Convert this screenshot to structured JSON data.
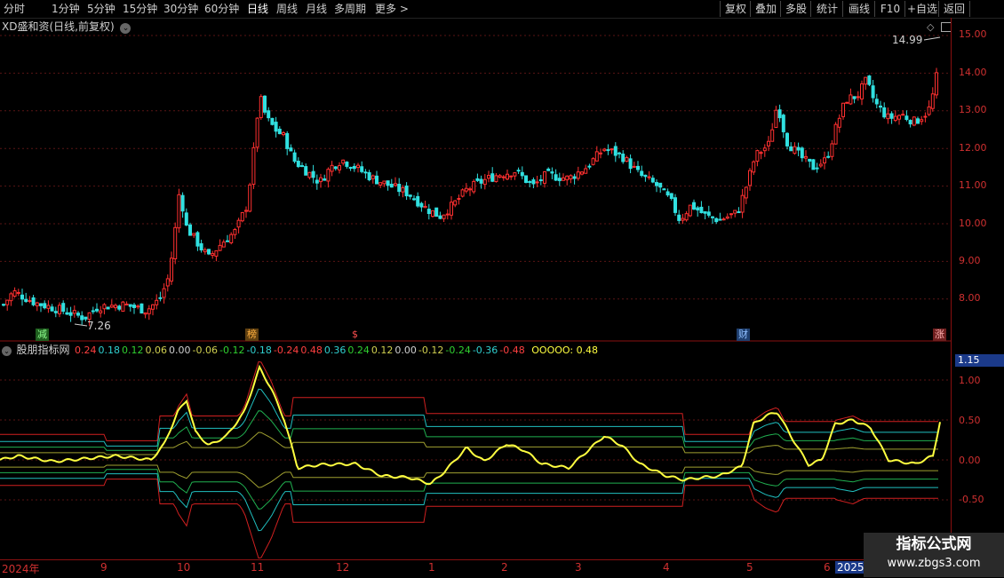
{
  "toolbar": {
    "timeframes": [
      "分时",
      "1分钟",
      "5分钟",
      "15分钟",
      "30分钟",
      "60分钟",
      "日线",
      "周线",
      "月线",
      "多周期",
      "更多 >"
    ],
    "active": "日线",
    "buttons": [
      "复权",
      "叠加",
      "多股",
      "统计",
      "画线",
      "F10",
      "+自选",
      "返回"
    ]
  },
  "stock": {
    "title": "XD盛和资(日线,前复权)"
  },
  "price_axis": {
    "ticks": [
      "15.00",
      "14.00",
      "13.00",
      "12.00",
      "11.00",
      "10.00",
      "9.00",
      "8.00"
    ]
  },
  "annotations": {
    "high_label": "14.99",
    "low_label": "7.26"
  },
  "events": [
    "减",
    "榜",
    "$",
    "财",
    "涨"
  ],
  "indicator": {
    "name": "股朋指标网",
    "values": [
      {
        "text": "0.24",
        "color": "#ff4040"
      },
      {
        "text": "0.18",
        "color": "#30d0d0"
      },
      {
        "text": "0.12",
        "color": "#30d030"
      },
      {
        "text": "0.06",
        "color": "#d0d050"
      },
      {
        "text": "0.00",
        "color": "#d0d0d0"
      },
      {
        "text": "-0.06",
        "color": "#d0d050"
      },
      {
        "text": "-0.12",
        "color": "#30d030"
      },
      {
        "text": "-0.18",
        "color": "#30d0d0"
      },
      {
        "text": "-0.24",
        "color": "#ff4040"
      },
      {
        "text": "0.48",
        "color": "#ff4040"
      },
      {
        "text": "0.36",
        "color": "#30d0d0"
      },
      {
        "text": "0.24",
        "color": "#30d030"
      },
      {
        "text": "0.12",
        "color": "#d0d050"
      },
      {
        "text": "0.00",
        "color": "#d0d0d0"
      },
      {
        "text": "-0.12",
        "color": "#d0d050"
      },
      {
        "text": "-0.24",
        "color": "#30d030"
      },
      {
        "text": "-0.36",
        "color": "#30d0d0"
      },
      {
        "text": "-0.48",
        "color": "#ff4040"
      }
    ],
    "main_label": "OOOOO: 0.48",
    "current_value": "1.15",
    "axis_ticks": [
      "1.00",
      "0.50",
      "0.00",
      "-0.50"
    ]
  },
  "date_axis": [
    "2024年",
    "9",
    "10",
    "11",
    "12",
    "1",
    "2",
    "3",
    "4",
    "5",
    "6",
    "2025/"
  ],
  "watermark": {
    "line1": "指标公式网",
    "line2": "www.zbgs3.com"
  },
  "colors": {
    "up": "#ff3030",
    "down": "#30e0e0",
    "main_line": "#ffff40",
    "axis": "#8a1010"
  }
}
